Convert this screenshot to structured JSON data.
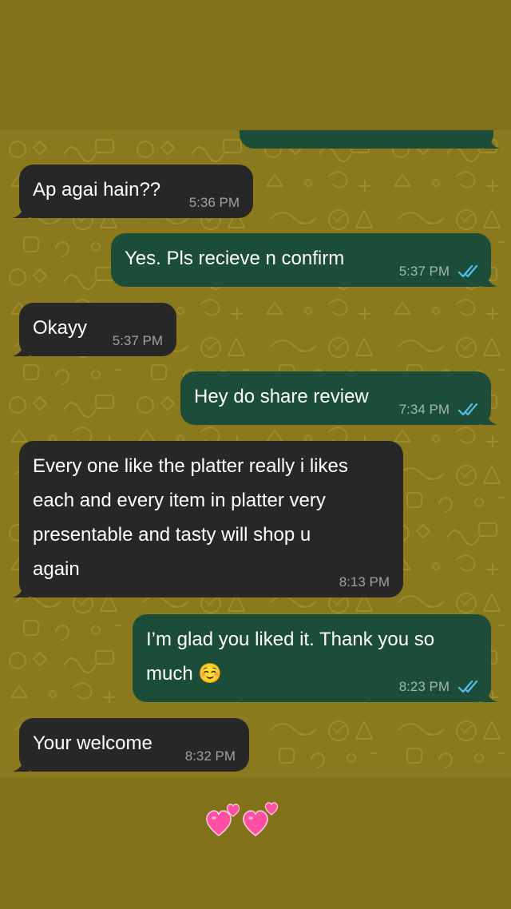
{
  "colors": {
    "outer_background": "#817219",
    "chat_background": "#8a7a1d",
    "incoming_bubble": "#272727",
    "outgoing_bubble": "#1b4d38",
    "read_ticks": "#53bdeb",
    "sticker_heart": "#ff4fa3"
  },
  "messages": [
    {
      "direction": "incoming",
      "text": "Ap agai hain??",
      "time": "5:36 PM"
    },
    {
      "direction": "outgoing",
      "text": "Yes. Pls recieve n confirm",
      "time": "5:37 PM",
      "status": "read"
    },
    {
      "direction": "incoming",
      "text": "Okayy",
      "time": "5:37 PM"
    },
    {
      "direction": "outgoing",
      "text": "Hey do share review",
      "time": "7:34 PM",
      "status": "read"
    },
    {
      "direction": "incoming",
      "lines": [
        "Every one like the platter really i likes",
        "each and every item in platter very",
        "presentable and tasty will shop u",
        "again"
      ],
      "time": "8:13 PM"
    },
    {
      "direction": "outgoing",
      "lines": [
        "I’m glad you liked it. Thank you so",
        "much ☺️"
      ],
      "time": "8:23 PM",
      "status": "read"
    },
    {
      "direction": "incoming",
      "text": "Your welcome",
      "time": "8:32 PM"
    }
  ],
  "sticker": {
    "icon": "two-hearts-icon"
  }
}
